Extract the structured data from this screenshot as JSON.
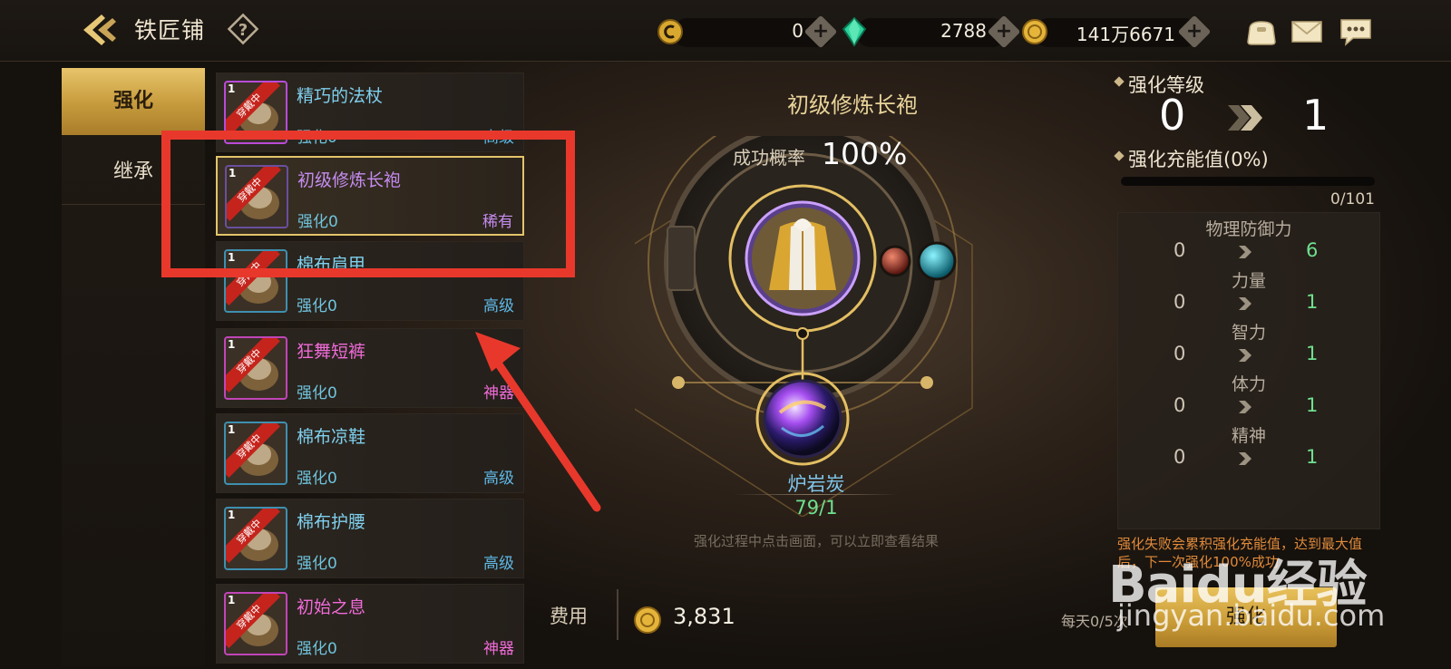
{
  "header": {
    "title": "铁匠铺",
    "currencies": [
      {
        "name": "contribution",
        "icon": "coin-c-icon",
        "value": "0"
      },
      {
        "name": "gem",
        "icon": "green-gem-icon",
        "value": "2788"
      },
      {
        "name": "gold",
        "icon": "gold-coin-icon",
        "value": "141万6671"
      }
    ]
  },
  "tabs": [
    {
      "label": "强化",
      "active": true
    },
    {
      "label": "继承",
      "active": false
    }
  ],
  "items": [
    {
      "name": "精巧的法杖",
      "enhance": "强化0",
      "rarity": "高级",
      "name_color": "#7fd0ee",
      "rarity_color": "#5fb8e6",
      "equipped": "穿戴中",
      "level": "1"
    },
    {
      "name": "初级修炼长袍",
      "enhance": "强化0",
      "rarity": "稀有",
      "name_color": "#c58cf0",
      "rarity_color": "#c58cf0",
      "equipped": "穿戴中",
      "level": "1",
      "selected": true
    },
    {
      "name": "棉布肩甲",
      "enhance": "强化0",
      "rarity": "高级",
      "name_color": "#7fd0ee",
      "rarity_color": "#5fb8e6",
      "equipped": "穿戴中",
      "level": "1"
    },
    {
      "name": "狂舞短裤",
      "enhance": "强化0",
      "rarity": "神器",
      "name_color": "#f06bd8",
      "rarity_color": "#f06bd8",
      "equipped": "穿戴中",
      "level": "1"
    },
    {
      "name": "棉布凉鞋",
      "enhance": "强化0",
      "rarity": "高级",
      "name_color": "#7fd0ee",
      "rarity_color": "#5fb8e6",
      "equipped": "穿戴中",
      "level": "1"
    },
    {
      "name": "棉布护腰",
      "enhance": "强化0",
      "rarity": "高级",
      "name_color": "#7fd0ee",
      "rarity_color": "#5fb8e6",
      "equipped": "穿戴中",
      "level": "1"
    },
    {
      "name": "初始之息",
      "enhance": "强化0",
      "rarity": "神器",
      "name_color": "#f06bd8",
      "rarity_color": "#f06bd8",
      "equipped": "穿戴中",
      "level": "1"
    }
  ],
  "center": {
    "item_title": "初级修炼长袍",
    "success_label": "成功概率",
    "success_value": "100%",
    "material_name": "炉岩炭",
    "material_count": "79/1",
    "hint": "强化过程中点击画面，可以立即查看结果"
  },
  "bottom": {
    "cost_label": "费用",
    "cost_value": "3,831",
    "daily": "每天0/5次",
    "confirm_label": "强化"
  },
  "right": {
    "level_label": "强化等级",
    "level_from": "0",
    "level_to": "1",
    "charge_label": "强化充能值(0%)",
    "charge_progress": 0,
    "charge_count": "0/101",
    "stats": [
      {
        "name": "物理防御力",
        "from": "0",
        "to": "6"
      },
      {
        "name": "力量",
        "from": "0",
        "to": "1"
      },
      {
        "name": "智力",
        "from": "0",
        "to": "1"
      },
      {
        "name": "体力",
        "from": "0",
        "to": "1"
      },
      {
        "name": "精神",
        "from": "0",
        "to": "1"
      }
    ],
    "fail_note": "强化失败会累积强化充能值，达到最大值后，下一次强化100%成功"
  },
  "watermark": {
    "brand": "Baidu经验",
    "url": "jingyan.baidu.com"
  },
  "colors": {
    "accent_gold": "#e3c46a",
    "highlight_red": "#e8382c",
    "stat_green": "#6ee08f"
  }
}
